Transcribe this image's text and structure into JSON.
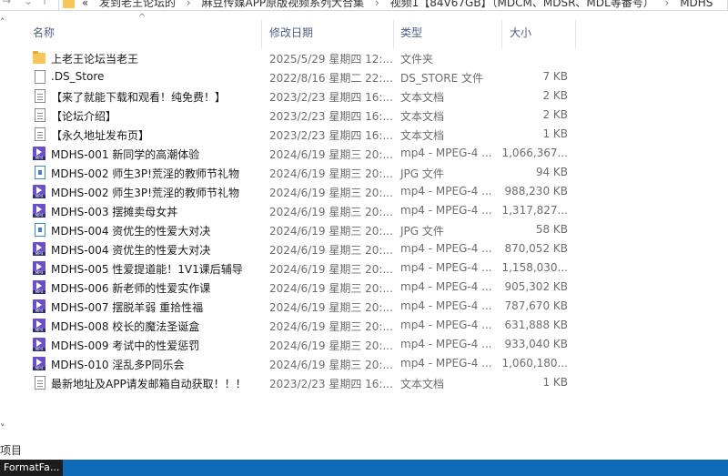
{
  "address_bar": {
    "crumbs": [
      "«",
      "发到老王论坛的",
      "麻豆传媒APP原版视频系列大合集",
      "视频1【84V67GB】（MDCM、MDSR、MDL等番号）",
      "MDHS"
    ]
  },
  "columns": {
    "name": "名称",
    "date": "修改日期",
    "type": "类型",
    "size": "大小"
  },
  "files": [
    {
      "icon": "folder",
      "name": "上老王论坛当老王",
      "date": "2025/5/29 星期四 12:...",
      "type": "文件夹",
      "size": ""
    },
    {
      "icon": "doc",
      "name": ".DS_Store",
      "date": "2022/8/16 星期二 22:...",
      "type": "DS_STORE 文件",
      "size": "7 KB"
    },
    {
      "icon": "txt",
      "name": "【来了就能下载和观看！纯免费！】",
      "date": "2023/2/23 星期四 16:...",
      "type": "文本文档",
      "size": "2 KB"
    },
    {
      "icon": "txt",
      "name": "【论坛介绍】",
      "date": "2023/2/23 星期四 16:...",
      "type": "文本文档",
      "size": "2 KB"
    },
    {
      "icon": "txt",
      "name": "【永久地址发布页】",
      "date": "2023/2/23 星期四 16:...",
      "type": "文本文档",
      "size": "1 KB"
    },
    {
      "icon": "mp4",
      "name": "MDHS-001 新同学的高潮体验",
      "date": "2024/6/19 星期三 20:...",
      "type": "mp4 - MPEG-4 ...",
      "size": "1,066,367..."
    },
    {
      "icon": "jpg",
      "name": "MDHS-002 师生3P!荒淫的教师节礼物",
      "date": "2024/6/19 星期三 20:...",
      "type": "JPG 文件",
      "size": "94 KB"
    },
    {
      "icon": "mp4",
      "name": "MDHS-002 师生3P!荒淫的教师节礼物",
      "date": "2024/6/19 星期三 20:...",
      "type": "mp4 - MPEG-4 ...",
      "size": "988,230 KB"
    },
    {
      "icon": "mp4",
      "name": "MDHS-003 摆摊卖母女丼",
      "date": "2024/6/19 星期三 20:...",
      "type": "mp4 - MPEG-4 ...",
      "size": "1,317,827..."
    },
    {
      "icon": "jpg",
      "name": "MDHS-004 资优生的性爱大对决",
      "date": "2024/6/19 星期三 20:...",
      "type": "JPG 文件",
      "size": "58 KB"
    },
    {
      "icon": "mp4",
      "name": "MDHS-004 资优生的性爱大对决",
      "date": "2024/6/19 星期三 20:...",
      "type": "mp4 - MPEG-4 ...",
      "size": "870,052 KB"
    },
    {
      "icon": "mp4",
      "name": "MDHS-005 性爱提道能！1V1课后辅导",
      "date": "2024/6/19 星期三 20:...",
      "type": "mp4 - MPEG-4 ...",
      "size": "1,158,030..."
    },
    {
      "icon": "mp4",
      "name": "MDHS-006 新老师的性爱实作课",
      "date": "2024/6/19 星期三 20:...",
      "type": "mp4 - MPEG-4 ...",
      "size": "905,302 KB"
    },
    {
      "icon": "mp4",
      "name": "MDHS-007 摆脱羊弱 重拾性福",
      "date": "2024/6/19 星期三 20:...",
      "type": "mp4 - MPEG-4 ...",
      "size": "787,670 KB"
    },
    {
      "icon": "mp4",
      "name": "MDHS-008 校长的魔法圣诞盒",
      "date": "2024/6/19 星期三 20:...",
      "type": "mp4 - MPEG-4 ...",
      "size": "631,888 KB"
    },
    {
      "icon": "mp4",
      "name": "MDHS-009 考试中的性爱惩罚",
      "date": "2024/6/19 星期三 20:...",
      "type": "mp4 - MPEG-4 ...",
      "size": "933,040 KB"
    },
    {
      "icon": "mp4",
      "name": "MDHS-010 淫乱多P同乐会",
      "date": "2024/6/19 星期三 20:...",
      "type": "mp4 - MPEG-4 ...",
      "size": "1,060,180..."
    },
    {
      "icon": "txt",
      "name": "最新地址及APP请发邮箱自动获取！！！",
      "date": "2023/2/23 星期四 16:...",
      "type": "文本文档",
      "size": "1 KB"
    }
  ],
  "status_bar": {
    "text": "项目"
  },
  "taskbar": {
    "item_label": "FormatFa..."
  },
  "colors": {
    "header_text": "#4d6082",
    "meta_text": "#6d6d6d",
    "folder": "#f7c55a",
    "mp4": "#6a4fc7",
    "taskbar": "#0c6ab7"
  }
}
